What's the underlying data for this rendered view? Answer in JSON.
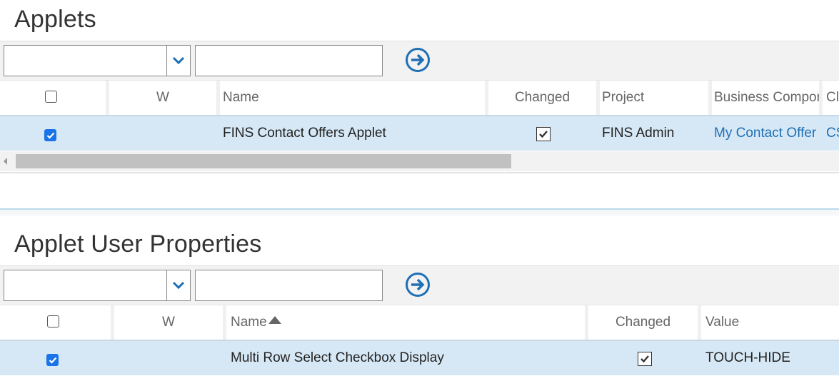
{
  "applets": {
    "title": "Applets",
    "search_field_value": "",
    "search_text_value": "",
    "columns": {
      "w": "W",
      "name": "Name",
      "changed": "Changed",
      "project": "Project",
      "business_component": "Business Compor",
      "class": "Cl"
    },
    "rows": [
      {
        "selected": true,
        "w": "",
        "name": "FINS Contact Offers Applet",
        "changed": true,
        "project": "FINS Admin",
        "business_component": "My Contact Offer",
        "class": "CS"
      }
    ]
  },
  "applet_user_properties": {
    "title": "Applet User Properties",
    "search_field_value": "",
    "search_text_value": "",
    "sort_column": "Name",
    "columns": {
      "w": "W",
      "name": "Name",
      "changed": "Changed",
      "value": "Value"
    },
    "rows": [
      {
        "selected": true,
        "w": "",
        "name": "Multi Row Select Checkbox Display",
        "changed": true,
        "value": "TOUCH-HIDE"
      }
    ]
  },
  "colors": {
    "accent": "#1f6fb5",
    "selected_row": "#d6e8f5",
    "checkbox_blue": "#1a73e8"
  },
  "icons": {
    "dropdown": "chevron-down-icon",
    "go": "arrow-right-circle-icon"
  }
}
